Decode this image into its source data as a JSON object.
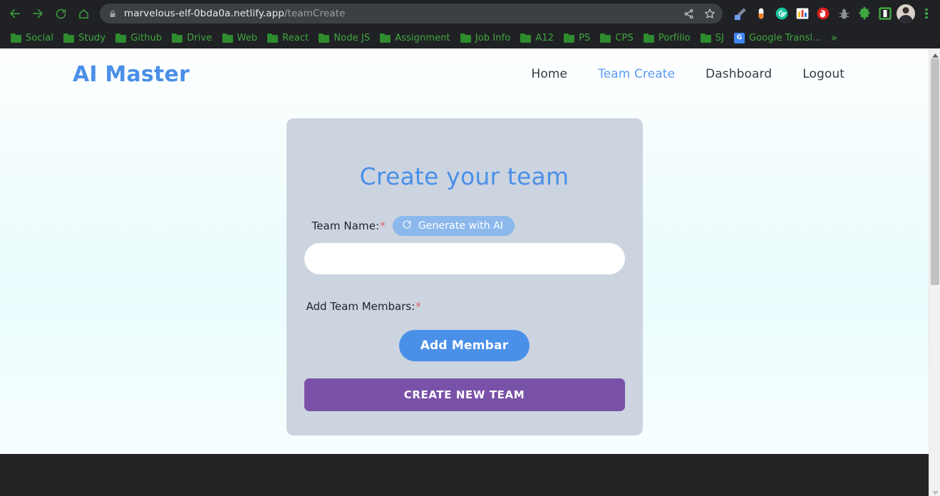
{
  "browser": {
    "nav": {
      "back_icon": "arrow-left-icon",
      "forward_icon": "arrow-right-icon",
      "reload_icon": "reload-icon",
      "home_icon": "home-icon"
    },
    "omnibox": {
      "lock_icon": "lock-icon",
      "url_domain": "marvelous-elf-0bda0a.netlify.app",
      "url_path": "/teamCreate",
      "share_icon": "share-icon",
      "bookmark_icon": "star-icon"
    },
    "extensions": [
      {
        "name": "eyedropper-extension-icon",
        "color": "#5b8def"
      },
      {
        "name": "pill-extension-icon",
        "color": "#f0842a"
      },
      {
        "name": "grammarly-extension-icon",
        "color": "#15c39a"
      },
      {
        "name": "chart-extension-icon",
        "color": "#ffffff"
      },
      {
        "name": "adblock-extension-icon",
        "color": "#e02020"
      },
      {
        "name": "bug-extension-icon",
        "color": "#9aa0a6"
      },
      {
        "name": "puzzle-extensions-icon",
        "color": "#3fa73f"
      },
      {
        "name": "square-extension-icon",
        "color": "#3fa73f"
      }
    ],
    "profile_avatar": "avatar",
    "menu_icon": "three-dots-menu-icon",
    "bookmarks": [
      {
        "label": "Social",
        "icon": "folder-icon"
      },
      {
        "label": "Study",
        "icon": "folder-icon"
      },
      {
        "label": "Github",
        "icon": "folder-icon"
      },
      {
        "label": "Drive",
        "icon": "folder-icon"
      },
      {
        "label": "Web",
        "icon": "folder-icon"
      },
      {
        "label": "React",
        "icon": "folder-icon"
      },
      {
        "label": "Node JS",
        "icon": "folder-icon"
      },
      {
        "label": "Assignment",
        "icon": "folder-icon"
      },
      {
        "label": "Job Info",
        "icon": "folder-icon"
      },
      {
        "label": "A12",
        "icon": "folder-icon"
      },
      {
        "label": "PS",
        "icon": "folder-icon"
      },
      {
        "label": "CPS",
        "icon": "folder-icon"
      },
      {
        "label": "Porfilio",
        "icon": "folder-icon"
      },
      {
        "label": "SJ",
        "icon": "folder-icon"
      },
      {
        "label": "Google Transl...",
        "icon": "google-translate-icon"
      }
    ],
    "bookmarks_overflow_label": "»"
  },
  "site": {
    "brand": "AI Master",
    "nav_links": [
      {
        "label": "Home",
        "active": false
      },
      {
        "label": "Team Create",
        "active": true
      },
      {
        "label": "Dashboard",
        "active": false
      },
      {
        "label": "Logout",
        "active": false
      }
    ]
  },
  "form": {
    "title": "Create your team",
    "team_name_label": "Team Name:",
    "required_marker": "*",
    "generate_ai_label": "Generate with AI",
    "generate_ai_icon": "refresh-icon",
    "team_name_value": "",
    "team_name_placeholder": "",
    "members_label": "Add Team Membars:",
    "add_member_label": "Add Membar",
    "create_team_label": "CREATE NEW TEAM"
  },
  "colors": {
    "brand_blue": "#4a90e8",
    "active_link_blue": "#5b9bf3",
    "card_bg": "#ccd4e0",
    "primary_button": "#4a90e8",
    "generate_button": "#8cb8ec",
    "create_button_purple": "#7a51a8",
    "required_red": "#e4606d",
    "footer_dark": "#232323",
    "bookmark_green": "#3fa73f"
  },
  "scrollbar": {
    "up_arrow_icon": "chevron-up-icon",
    "down_arrow_icon": "chevron-down-icon"
  }
}
